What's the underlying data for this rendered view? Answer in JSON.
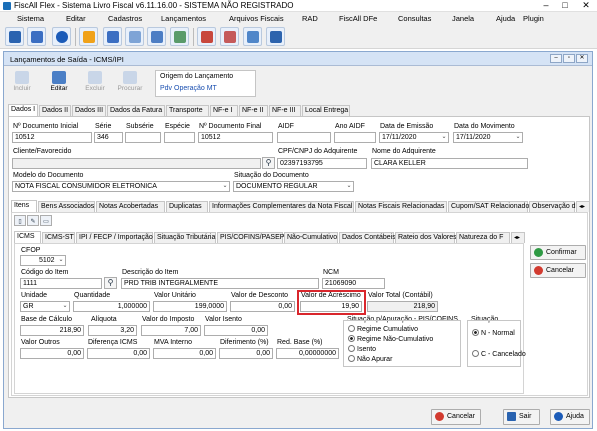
{
  "app": {
    "title": "FiscAll Flex - Sistema Livro Fiscal v6.11.16.00 - SISTEMA NÃO REGISTRADO"
  },
  "menu": [
    "Sistema",
    "Editar",
    "Cadastros",
    "Lançamentos",
    "Arquivos Fiscais",
    "RAD",
    "FiscAll DFe",
    "Consultas",
    "Janela",
    "Ajuda",
    "Plugin"
  ],
  "window": {
    "title": "Lançamentos de Saída - ICMS/IPI"
  },
  "actions": {
    "incluir": "Incluir",
    "editar": "Editar",
    "excluir": "Excluir",
    "procurar": "Procurar"
  },
  "origem": {
    "label": "Origem do Lançamento",
    "value": "Pdv Operação MT"
  },
  "tabs": [
    "Dados I",
    "Dados II",
    "Dados III",
    "Dados da Fatura",
    "Transporte",
    "NF-e I",
    "NF-e II",
    "NF-e III",
    "Local Entrega"
  ],
  "doc": {
    "l_num": "Nº Documento Inicial",
    "num": "10512",
    "l_serie": "Série",
    "serie": "346",
    "l_subserie": "Subsérie",
    "l_especie": "Espécie",
    "l_numfim": "Nº Documento Final",
    "numfim": "10512",
    "l_aidf": "AIDF",
    "l_anoaidf": "Ano AIDF",
    "l_emissao": "Data de Emissão",
    "emissao": "17/11/2020",
    "l_movimento": "Data do Movimento",
    "movimento": "17/11/2020",
    "l_cliente": "Cliente/Favorecido",
    "l_cpf": "CPF/CNPJ do Adquirente",
    "cpf": "02397193795",
    "l_nome": "Nome do Adquirente",
    "nome": "CLARA KELLER",
    "l_modelo": "Modelo do Documento",
    "modelo": "NOTA FISCAL CONSUMIDOR ELETRONICA",
    "l_situacao": "Situação do Documento",
    "situacao": "DOCUMENTO REGULAR"
  },
  "subtabs": [
    "Itens",
    "Bens Associados",
    "Notas Acobertadas",
    "Duplicatas",
    "Informações Complementares da Nota Fiscal",
    "Notas Fiscais Relacionadas",
    "Cupom/SAT Relacionados",
    "Observação d"
  ],
  "itemtabs": [
    "ICMS",
    "ICMS-ST",
    "IPI / FECP / Importação",
    "Situação Tributária",
    "PIS/COFINS/PASEP",
    "Não-Cumulativo",
    "Dados Contábeis",
    "Rateio dos Valores",
    "Natureza do F"
  ],
  "item": {
    "l_cfop": "CFOP",
    "cfop": "5102",
    "l_codigo": "Código do Item",
    "codigo": "1111",
    "l_desc": "Descrição do Item",
    "desc": "PRD TRIB INTEGRALMENTE",
    "l_ncm": "NCM",
    "ncm": "21069090",
    "l_unidade": "Unidade",
    "unidade": "GR",
    "l_qtd": "Quantidade",
    "qtd": "1,000000",
    "l_vunit": "Valor Unitário",
    "vunit": "199,0000",
    "l_desconto": "Valor de Desconto",
    "desconto": "0,00",
    "l_acrescimo": "Valor de Acréscimo",
    "acrescimo": "19,90",
    "l_vtotal": "Valor Total (Contábil)",
    "vtotal": "218,90",
    "l_base": "Base de Cálculo",
    "base": "218,90",
    "l_aliq": "Alíquota",
    "aliq": "3,20",
    "l_vimp": "Valor do Imposto",
    "vimp": "7,00",
    "l_visento": "Valor Isento",
    "visento": "0,00",
    "l_voutros": "Valor Outros",
    "voutros": "0,00",
    "l_dif": "Diferença ICMS",
    "dif": "0,00",
    "l_mva": "MVA Interno",
    "mva": "0,00",
    "l_diferim": "Diferimento (%)",
    "diferim": "0,00",
    "l_red": "Red. Base (%)",
    "red": "0,00000000",
    "l_sitpis": "Situação p/Apuração - PIS/COFINS",
    "pis": [
      "Regime Cumulativo",
      "Regime Não-Cumulativo",
      "Isento",
      "Não Apurar"
    ],
    "l_sit": "Situação",
    "sit": [
      "N - Normal",
      "C - Cancelado"
    ]
  },
  "buttons": {
    "confirmar": "Confirmar",
    "cancelar": "Cancelar",
    "cancelar2": "Cancelar",
    "sair": "Sair",
    "ajuda": "Ajuda"
  }
}
